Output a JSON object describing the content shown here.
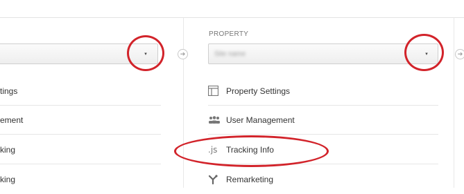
{
  "property_panel": {
    "section_label": "PROPERTY",
    "selected_value": "Site name",
    "items": [
      {
        "label": "Property Settings",
        "icon": "window-layout-icon"
      },
      {
        "label": "User Management",
        "icon": "users-group-icon"
      },
      {
        "label": "Tracking Info",
        "icon": "js-icon",
        "icon_text": ".js"
      },
      {
        "label": "Remarketing",
        "icon": "remarketing-icon"
      }
    ]
  },
  "account_panel": {
    "items": [
      {
        "label": "tings"
      },
      {
        "label": "ement"
      },
      {
        "label": "king"
      },
      {
        "label": "king"
      }
    ]
  },
  "annotations": {
    "highlight_color": "#d2232a"
  },
  "icons": {
    "caret": "▾",
    "next_arrow": "➔"
  }
}
